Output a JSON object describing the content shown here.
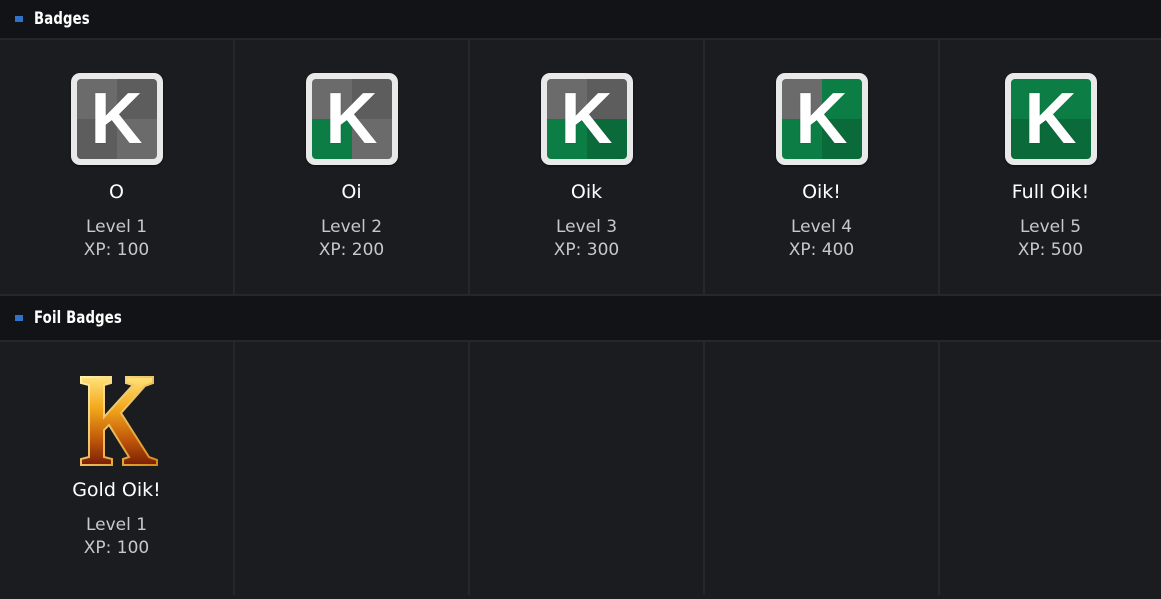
{
  "sections": {
    "badges": {
      "title": "Badges",
      "items": [
        {
          "name": "O",
          "level": "Level 1",
          "xp": "XP: 100",
          "icon": "k-badge-level-1-icon"
        },
        {
          "name": "Oi",
          "level": "Level 2",
          "xp": "XP: 200",
          "icon": "k-badge-level-2-icon"
        },
        {
          "name": "Oik",
          "level": "Level 3",
          "xp": "XP: 300",
          "icon": "k-badge-level-3-icon"
        },
        {
          "name": "Oik!",
          "level": "Level 4",
          "xp": "XP: 400",
          "icon": "k-badge-level-4-icon"
        },
        {
          "name": "Full Oik!",
          "level": "Level 5",
          "xp": "XP: 500",
          "icon": "k-badge-level-5-icon"
        }
      ]
    },
    "foil": {
      "title": "Foil Badges",
      "items": [
        {
          "name": "Gold Oik!",
          "level": "Level 1",
          "xp": "XP: 100",
          "icon": "gold-k-badge-icon"
        }
      ]
    }
  },
  "colors": {
    "background": "#1b1c20",
    "header_bg": "#121316",
    "accent": "#2f72c8",
    "badge_gray": "#6b6b6b",
    "badge_green": "#0c7d44",
    "gold": "#f0b020"
  }
}
